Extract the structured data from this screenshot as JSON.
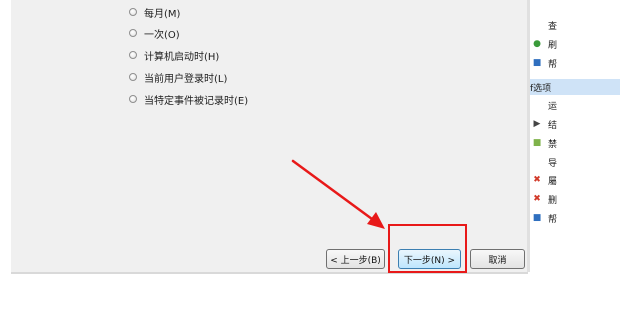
{
  "radio_options": [
    {
      "label": "每月(M)"
    },
    {
      "label": "一次(O)"
    },
    {
      "label": "计算机启动时(H)"
    },
    {
      "label": "当前用户登录时(L)"
    },
    {
      "label": "当特定事件被记录时(E)"
    }
  ],
  "buttons": {
    "back": "< 上一步(B)",
    "next": "下一步(N) >",
    "cancel": "取消"
  },
  "right_pane": {
    "items": [
      {
        "icon": "",
        "label": "查"
      },
      {
        "icon": "●",
        "label": "刷"
      },
      {
        "icon": "■",
        "label": "帮"
      },
      {
        "icon": "",
        "label": "f选项"
      },
      {
        "icon": "",
        "label": "运"
      },
      {
        "icon": "▶",
        "label": "结"
      },
      {
        "icon": "■",
        "label": "禁"
      },
      {
        "icon": "",
        "label": "导"
      },
      {
        "icon": "✖",
        "label": "屬"
      },
      {
        "icon": "✖",
        "label": "删"
      },
      {
        "icon": "■",
        "label": "帮"
      }
    ]
  },
  "colors": {
    "annotation": "#e81919",
    "dialog_bg": "#f0f0f0",
    "selected_bg": "#cfe3f7"
  }
}
